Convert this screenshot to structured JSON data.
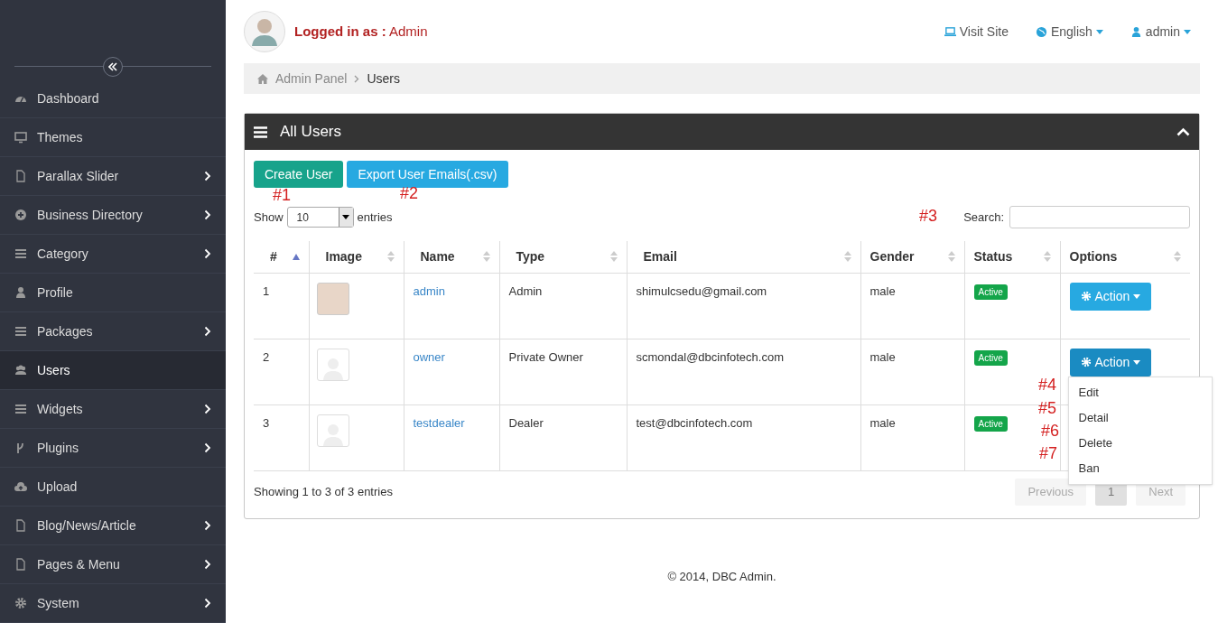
{
  "sidebar": {
    "items": [
      {
        "label": "Dashboard",
        "kind": "gauge",
        "has_submenu": false,
        "selected": false
      },
      {
        "label": "Themes",
        "kind": "monitor",
        "has_submenu": false,
        "selected": false
      },
      {
        "label": "Parallax Slider",
        "kind": "file",
        "has_submenu": true,
        "selected": false
      },
      {
        "label": "Business Directory",
        "kind": "plus",
        "has_submenu": true,
        "selected": false
      },
      {
        "label": "Category",
        "kind": "bars",
        "has_submenu": true,
        "selected": false
      },
      {
        "label": "Profile",
        "kind": "user",
        "has_submenu": false,
        "selected": false
      },
      {
        "label": "Packages",
        "kind": "bars",
        "has_submenu": true,
        "selected": false
      },
      {
        "label": "Users",
        "kind": "users",
        "has_submenu": false,
        "selected": true
      },
      {
        "label": "Widgets",
        "kind": "bars",
        "has_submenu": true,
        "selected": false
      },
      {
        "label": "Plugins",
        "kind": "fork",
        "has_submenu": true,
        "selected": false
      },
      {
        "label": "Upload",
        "kind": "cloud",
        "has_submenu": false,
        "selected": false
      },
      {
        "label": "Blog/News/Article",
        "kind": "file",
        "has_submenu": true,
        "selected": false
      },
      {
        "label": "Pages & Menu",
        "kind": "file",
        "has_submenu": true,
        "selected": false
      },
      {
        "label": "System",
        "kind": "gear",
        "has_submenu": true,
        "selected": false
      }
    ]
  },
  "header": {
    "logged_in_label": "Logged in as :",
    "user": "Admin",
    "links": [
      {
        "label": "Visit Site",
        "kind": "laptop",
        "dropdown": false
      },
      {
        "label": "English",
        "kind": "globe",
        "dropdown": true
      },
      {
        "label": "admin",
        "kind": "user",
        "dropdown": true
      }
    ]
  },
  "breadcrumb": [
    "Admin Panel",
    "Users"
  ],
  "panel": {
    "title": "All Users",
    "buttons": [
      {
        "label": "Create User",
        "kind": "teal"
      },
      {
        "label": "Export User Emails(.csv)",
        "kind": "sky"
      }
    ],
    "show_label": "Show",
    "page_size": "10",
    "entries_label": "entries",
    "search_label": "Search:",
    "columns": [
      "#",
      "Image",
      "Name",
      "Type",
      "Email",
      "Gender",
      "Status",
      "Options"
    ],
    "rows": [
      {
        "number": "1",
        "kind": "photo",
        "name": "admin",
        "type": "Admin",
        "email": "shimulcsedu@gmail.com",
        "gender": "male",
        "status": "Active",
        "action": "Action",
        "open": false
      },
      {
        "number": "2",
        "kind": "silhouette",
        "name": "owner",
        "type": "Private Owner",
        "email": "scmondal@dbcinfotech.com",
        "gender": "male",
        "status": "Active",
        "action": "Action",
        "open": true
      },
      {
        "number": "3",
        "kind": "silhouette",
        "name": "testdealer",
        "type": "Dealer",
        "email": "test@dbcinfotech.com",
        "gender": "male",
        "status": "Active"
      }
    ],
    "menu": [
      "Edit",
      "Detail",
      "Delete",
      "Ban"
    ],
    "info": "Showing 1 to 3 of 3 entries",
    "pages": [
      {
        "label": "Previous",
        "disabled": true,
        "selected": false
      },
      {
        "label": "1",
        "disabled": false,
        "selected": true
      },
      {
        "label": "Next",
        "disabled": true,
        "selected": false
      }
    ]
  },
  "annotations": [
    "#1",
    "#2",
    "#3",
    "#4",
    "#5",
    "#6",
    "#7"
  ],
  "footer": "© 2014, DBC Admin."
}
